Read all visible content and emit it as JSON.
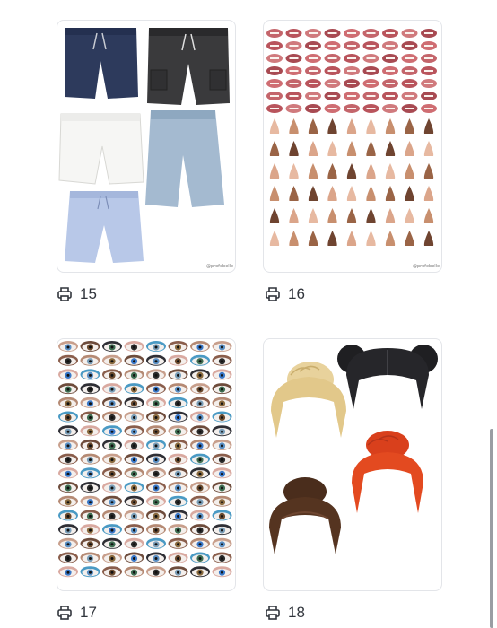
{
  "items": [
    {
      "count": "15",
      "watermark": "@profebelle",
      "subject": "shorts"
    },
    {
      "count": "16",
      "watermark": "@profebelle",
      "subject": "mouths-and-noses"
    },
    {
      "count": "17",
      "subject": "eyes"
    },
    {
      "count": "18",
      "subject": "hair-buns"
    }
  ],
  "icons": {
    "print": "printer-icon"
  },
  "colors": {
    "border": "#e3e5e9",
    "text": "#31353c",
    "scrollbar": "#9a9da3"
  }
}
